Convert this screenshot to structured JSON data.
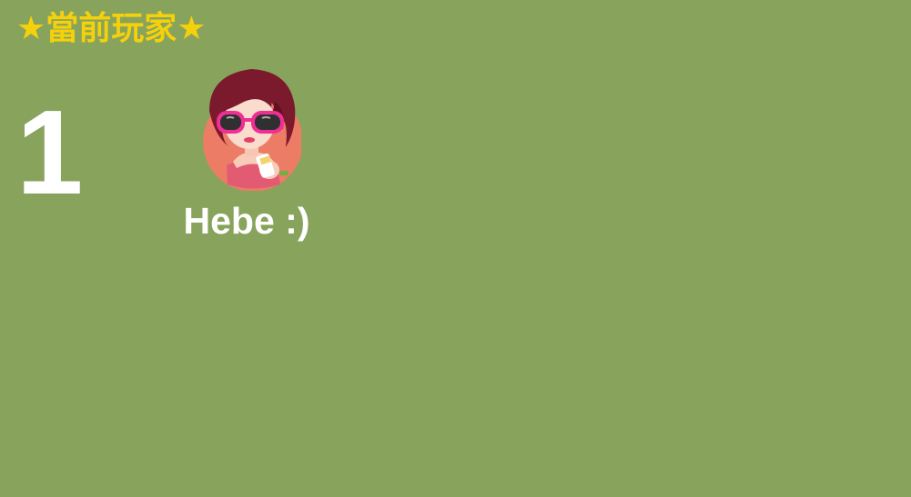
{
  "colors": {
    "background": "#88a35c",
    "title": "#f5d10c",
    "text": "#ffffff"
  },
  "header": {
    "title": "★當前玩家★"
  },
  "player": {
    "number": "1",
    "name": "Hebe :)",
    "avatar_icon": "girl-sunglasses-avatar-icon"
  }
}
